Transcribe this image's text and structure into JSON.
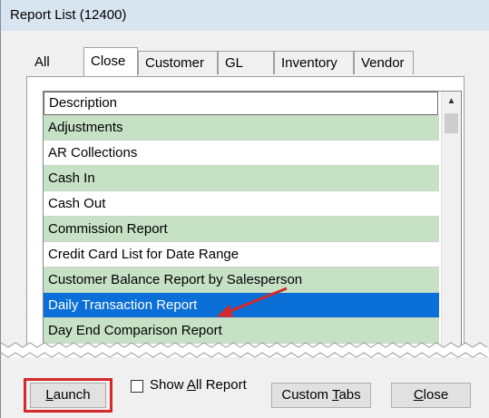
{
  "window": {
    "title": "Report List (12400)"
  },
  "tabs": [
    {
      "label": "All"
    },
    {
      "label": "Close",
      "active": true
    },
    {
      "label": "Customer"
    },
    {
      "label": "GL"
    },
    {
      "label": "Inventory"
    },
    {
      "label": "Vendor"
    }
  ],
  "list": {
    "header": "Description",
    "rows": [
      {
        "label": "Adjustments",
        "style": "green"
      },
      {
        "label": "AR Collections",
        "style": "white"
      },
      {
        "label": "Cash In",
        "style": "green"
      },
      {
        "label": "Cash Out",
        "style": "white"
      },
      {
        "label": "Commission Report",
        "style": "green"
      },
      {
        "label": "Credit Card List for Date Range",
        "style": "white"
      },
      {
        "label": "Customer Balance Report by Salesperson",
        "style": "green"
      },
      {
        "label": "Daily Transaction Report",
        "style": "selected"
      },
      {
        "label": "Day End Comparison Report",
        "style": "green"
      }
    ]
  },
  "footer": {
    "launch_label_underlined": "L",
    "launch_label_rest": "aunch",
    "show_all_prefix": "Show ",
    "show_all_underlined": "A",
    "show_all_rest": "ll Report",
    "custom_tabs_prefix": "Custom ",
    "custom_tabs_underlined": "T",
    "custom_tabs_rest": "abs",
    "close_underlined": "C",
    "close_rest": "lose"
  },
  "colors": {
    "selection": "#0a6fd6",
    "row_alt": "#c6e1c6",
    "annotation": "#d32a2a"
  }
}
